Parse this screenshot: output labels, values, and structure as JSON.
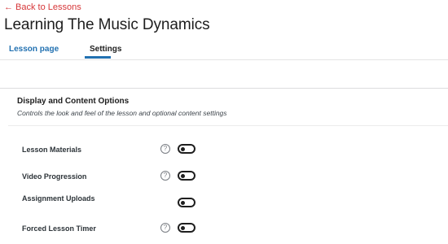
{
  "header": {
    "back_label": "Back to Lessons",
    "title": "Learning The Music Dynamics"
  },
  "tabs": [
    {
      "label": "Lesson page",
      "active": false
    },
    {
      "label": "Settings",
      "active": true
    }
  ],
  "section": {
    "title": "Display and Content Options",
    "description": "Controls the look and feel of the lesson and optional content settings"
  },
  "settings": [
    {
      "label": "Lesson Materials",
      "has_help": true,
      "enabled": false
    },
    {
      "label": "Video Progression",
      "has_help": true,
      "enabled": false
    },
    {
      "label": "Assignment Uploads",
      "has_help": false,
      "enabled": false
    },
    {
      "label": "Forced Lesson Timer",
      "has_help": true,
      "enabled": false
    }
  ],
  "icons": {
    "back": "arrow-left-icon",
    "help": "question-circle-icon"
  },
  "colors": {
    "back_link": "#d63638",
    "tab_active": "#2271b1",
    "text": "#1e1e1e"
  }
}
